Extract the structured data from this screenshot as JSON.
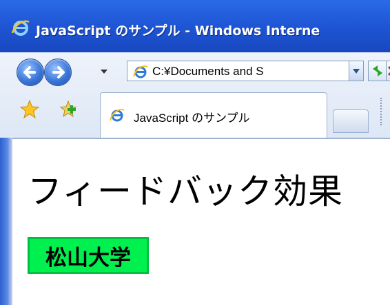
{
  "window": {
    "title": "JavaScript のサンプル - Windows Interne",
    "app_icon": "ie-logo-icon"
  },
  "toolbar": {
    "back_icon": "back-arrow-icon",
    "forward_icon": "forward-arrow-icon",
    "address": "C:¥Documents and S",
    "go_icon": "refresh-go-icon",
    "stop_icon": "stop-x-icon"
  },
  "tabs": {
    "favorites_icon": "favorites-star-icon",
    "add_favorite_icon": "add-favorite-icon",
    "active_tab_label": "JavaScript のサンプル"
  },
  "page": {
    "heading": "フィードバック効果",
    "label": "松山大学",
    "label_color": "#00f050"
  }
}
